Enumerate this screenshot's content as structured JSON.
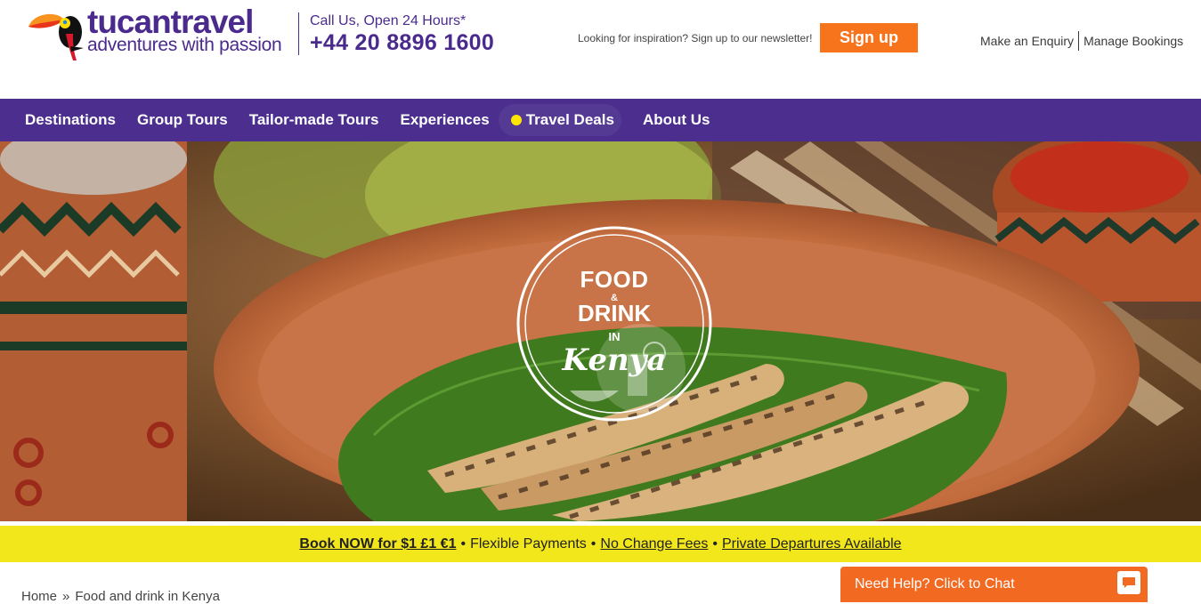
{
  "header": {
    "logo_name": "tucantravel",
    "logo_tagline": "adventures with passion",
    "call_label": "Call Us, Open 24 Hours*",
    "call_number": "+44 20 8896 1600",
    "newsletter_text": "Looking for inspiration? Sign up to our newsletter!",
    "signup_label": "Sign up",
    "enquiry_label": "Make an Enquiry",
    "bookings_label": "Manage Bookings"
  },
  "nav": {
    "items": [
      "Destinations",
      "Group Tours",
      "Tailor-made Tours",
      "Experiences",
      "Travel Deals",
      "About Us"
    ]
  },
  "hero": {
    "badge_food": "FOOD",
    "badge_amp": "&",
    "badge_drink": "DRINK",
    "badge_in": "IN",
    "badge_kenya": "Kenya"
  },
  "promo": {
    "book_now": "Book NOW for $1 £1 €1",
    "flexible": "Flexible Payments",
    "no_change": "No Change Fees",
    "private": "Private Departures Available",
    "bullet": "•"
  },
  "breadcrumb": {
    "home": "Home",
    "sep": "»",
    "current": "Food and drink in Kenya"
  },
  "chat": {
    "label": "Need Help? Click to Chat"
  },
  "colors": {
    "brand_purple": "#4b2e8e",
    "accent_orange": "#f7731c",
    "promo_yellow": "#f2e71a"
  }
}
